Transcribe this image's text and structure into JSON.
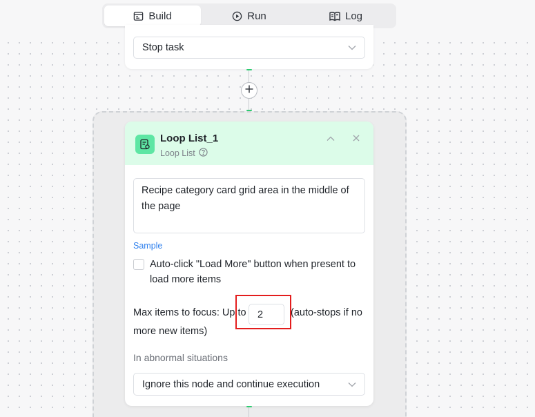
{
  "tabs": [
    {
      "label": "Build",
      "icon": "build-icon",
      "active": true
    },
    {
      "label": "Run",
      "icon": "play-circle-icon",
      "active": false
    },
    {
      "label": "Log",
      "icon": "book-icon",
      "active": false
    }
  ],
  "previous_node": {
    "select_value": "Stop task"
  },
  "loop_node": {
    "title": "Loop List_1",
    "subtitle": "Loop List",
    "description": "Recipe category card grid area in the middle of the page",
    "sample_link": "Sample",
    "auto_click_label": "Auto-click \"Load More\" button when present to load more items",
    "auto_click_checked": false,
    "max_items_prefix": "Max items to focus: Up to",
    "max_items_value": "2",
    "max_items_suffix_1": "(auto-stops if no",
    "max_items_suffix_2": "more new items)",
    "abnormal_label": "In abnormal situations",
    "abnormal_select_value": "Ignore this node and continue execution"
  },
  "colors": {
    "accent_green": "#2ecc71",
    "header_bg": "#dcfce9",
    "icon_bg": "#5ee6a4",
    "link_blue": "#2f80ed",
    "highlight_red": "#e31d1d"
  }
}
